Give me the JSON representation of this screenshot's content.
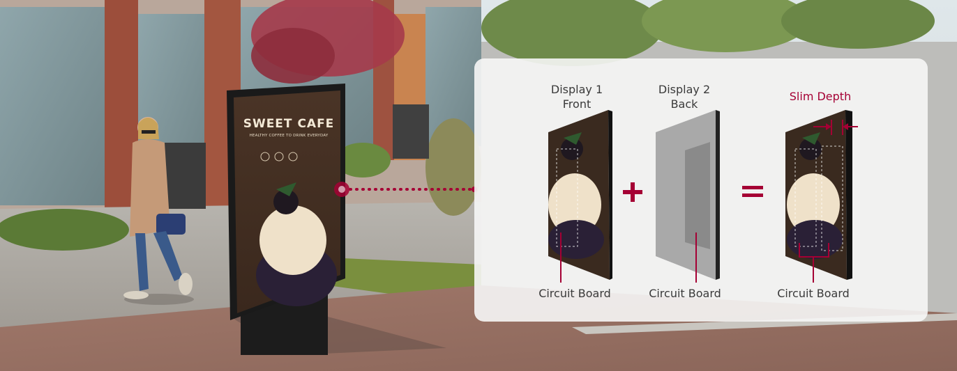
{
  "scene": {
    "sign": {
      "title": "SWEET CAFE",
      "subtitle": "HEALTHY COFFEE TO DRINK EVERYDAY"
    }
  },
  "diagram": {
    "display1_label": "Display 1\nFront",
    "display2_label": "Display 2\nBack",
    "slim_depth_label": "Slim Depth",
    "circuit_board_label_1": "Circuit Board",
    "circuit_board_label_2": "Circuit Board",
    "circuit_board_label_3": "Circuit Board",
    "plus_symbol": "+",
    "equals_symbol": "=",
    "accent_color": "#a50034"
  }
}
